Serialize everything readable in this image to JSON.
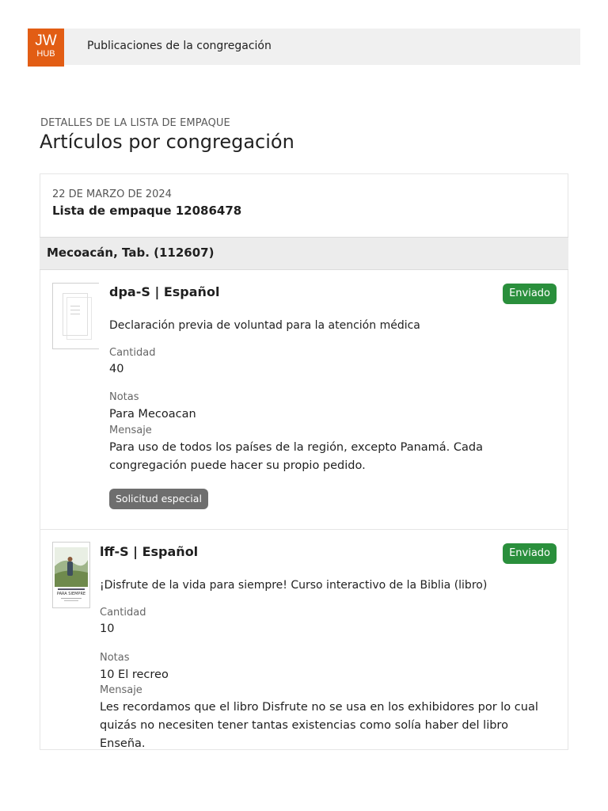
{
  "header": {
    "logo_line1": "JW",
    "logo_line2": "HUB",
    "app_title": "Publicaciones de la congregación"
  },
  "page": {
    "overline": "DETALLES DE LA LISTA DE EMPAQUE",
    "title": "Artículos por congregación"
  },
  "packing_list": {
    "date": "22 DE MARZO DE 2024",
    "title": "Lista de empaque 12086478",
    "congregation": "Mecoacán, Tab. (112607)",
    "items": [
      {
        "title": "dpa-S | Español",
        "status": "Enviado",
        "description": "Declaración previa de voluntad para la atención médica",
        "quantity_label": "Cantidad",
        "quantity": "40",
        "notes_label": "Notas",
        "notes": "Para Mecoacan",
        "message_label": "Mensaje",
        "message": "Para uso de todos los países de la región, excepto Panamá. Cada congregación puede hacer su propio pedido.",
        "tag": "Solicitud especial",
        "thumbnail_icon": "document-icon"
      },
      {
        "title": "lff-S | Español",
        "status": "Enviado",
        "description": "¡Disfrute de la vida para siempre! Curso interactivo de la Biblia (libro)",
        "quantity_label": "Cantidad",
        "quantity": "10",
        "notes_label": "Notas",
        "notes": "10 El recreo",
        "message_label": "Mensaje",
        "message": "Les recordamos que el libro Disfrute no se usa en los exhibidores por lo cual quizás no necesiten tener tantas existencias como solía haber del libro Enseña.",
        "thumbnail_icon": "book-cover-image"
      }
    ]
  },
  "colors": {
    "brand": "#e25d14",
    "status_sent": "#2a8f3c",
    "tag_bg": "#6e6e6e",
    "bar_bg": "#f0f0f0"
  }
}
